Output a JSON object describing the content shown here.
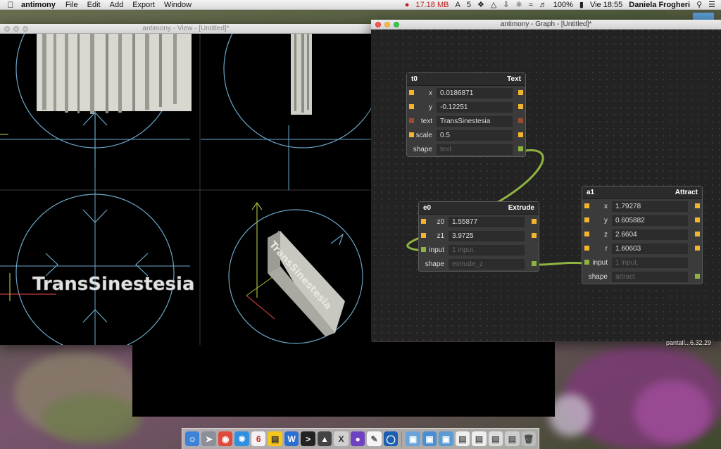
{
  "menubar": {
    "app_name": "antimony",
    "menus": [
      "File",
      "Edit",
      "Add",
      "Export",
      "Window"
    ],
    "memory": "17.18 MB",
    "adobe_count": "5",
    "battery": "100%",
    "clock": "Vie 18:55",
    "user": "Daniela Frogheri"
  },
  "view_window": {
    "title": "antimony - View - [Untitled]*",
    "quad_text": "TransSinestesia",
    "iso_text": "TransSinestesia"
  },
  "graph_window": {
    "title": "antimony - Graph - [Untitled]*",
    "nodes": {
      "t0": {
        "name": "t0",
        "type": "Text",
        "rows": [
          {
            "label": "x",
            "value": "0.0186871"
          },
          {
            "label": "y",
            "value": "-0.12251"
          },
          {
            "label": "text",
            "value": "TransSinestesia"
          },
          {
            "label": "scale",
            "value": "0.5"
          },
          {
            "label": "shape",
            "value": "text"
          }
        ]
      },
      "e0": {
        "name": "e0",
        "type": "Extrude",
        "rows": [
          {
            "label": "z0",
            "value": "1.55877"
          },
          {
            "label": "z1",
            "value": "3.9725"
          },
          {
            "label": "input",
            "value": "1 input."
          },
          {
            "label": "shape",
            "value": "extrude_z"
          }
        ]
      },
      "a1": {
        "name": "a1",
        "type": "Attract",
        "rows": [
          {
            "label": "x",
            "value": "1.79278"
          },
          {
            "label": "y",
            "value": "0.605882"
          },
          {
            "label": "z",
            "value": "2.6604"
          },
          {
            "label": "r",
            "value": "1.60603"
          },
          {
            "label": "input",
            "value": "1 input."
          },
          {
            "label": "shape",
            "value": "attract"
          }
        ]
      }
    }
  },
  "desktop": {
    "file_label": "pantall...6.32.29"
  },
  "colors": {
    "port_value": "#f3b42e",
    "port_text": "#9a4d2c",
    "port_shape": "#8fb340",
    "wire": "#8fb340",
    "guide": "#6aa7c8"
  }
}
